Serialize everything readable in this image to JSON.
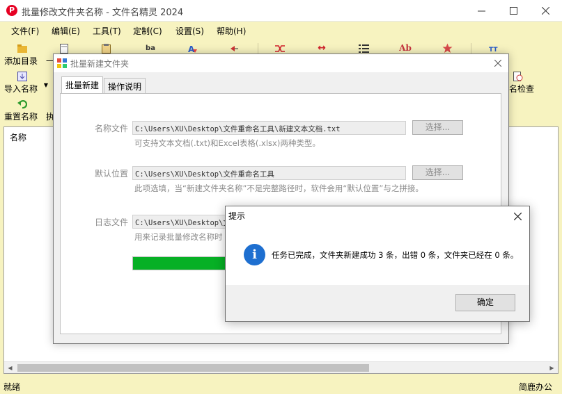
{
  "window": {
    "title": "批量修改文件夹名称 - 文件名精灵 2024",
    "app_icon_glyph": "P",
    "minimize_label": "minimize",
    "maximize_label": "maximize",
    "close_label": "close"
  },
  "menubar": {
    "items": [
      "文件(F)",
      "编辑(E)",
      "工具(T)",
      "定制(C)",
      "设置(S)",
      "帮助(H)"
    ]
  },
  "toolbar": {
    "add_dir": "添加目录",
    "import_names": "导入名称",
    "reset_names": "重置名称",
    "exec_partial": "执",
    "name_check_partial": "名检查",
    "row1_dash": "一",
    "icon_glyphs": {
      "ba": "ba",
      "arrows": "↔",
      "ab": "Ab"
    }
  },
  "list": {
    "header_name": "名称"
  },
  "statusbar": {
    "left": "就绪",
    "right": "简鹿办公"
  },
  "dialog": {
    "title": "批量新建文件夹",
    "tabs": [
      "批量新建",
      "操作说明"
    ],
    "name_file_label": "名称文件",
    "name_file_value": "C:\\Users\\XU\\Desktop\\文件重命名工具\\新建文本文档.txt",
    "name_file_hint": "可支持文本文档(.txt)和Excel表格(.xlsx)两种类型。",
    "default_loc_label": "默认位置",
    "default_loc_value": "C:\\Users\\XU\\Desktop\\文件重命名工具",
    "default_loc_hint": "此项选填，当“新建文件夹名称”不是完整路径时，软件会用“默认位置”与之拼接。",
    "log_file_label": "日志文件",
    "log_file_value": "C:\\Users\\XU\\Desktop\\文",
    "log_file_hint": "用来记录批量修改名称时",
    "choose_btn": "选择...",
    "progress": 1.0
  },
  "messagebox": {
    "title": "提示",
    "icon": "i",
    "text": "任务已完成，文件夹新建成功 3 条，出错 0 条，文件夹已经在 0 条。",
    "ok": "确定"
  },
  "colors": {
    "app_bg": "#f7f3c0",
    "progress_fill": "#06b025",
    "info_icon": "#1e6fd0"
  }
}
